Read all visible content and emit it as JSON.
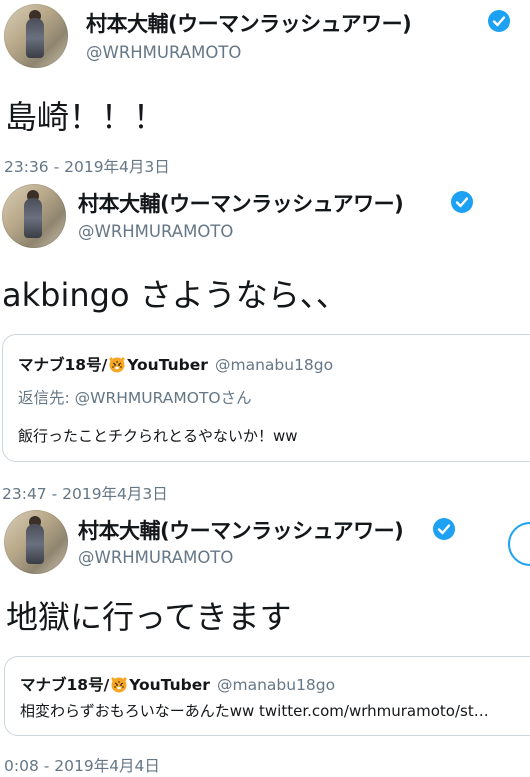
{
  "colors": {
    "verified": "#1da1f2",
    "text": "#14171a",
    "muted": "#657786",
    "border": "#ccd6dd"
  },
  "tweets": [
    {
      "name": "村本大輔(ウーマンラッシュアワー)",
      "handle": "@WRHMURAMOTO",
      "text": "島崎！！！",
      "timestamp": "23:36 - 2019年4月3日",
      "verified_icon": "verified-badge-icon"
    },
    {
      "name": "村本大輔(ウーマンラッシュアワー)",
      "handle": "@WRHMURAMOTO",
      "text": "akbingo さようなら、、",
      "quote": {
        "name_prefix": "マナブ18号/",
        "name_suffix": "YouTuber",
        "handle": "@manabu18go",
        "reply_label": "返信先: ",
        "reply_to": "@WRHMURAMOTOさん",
        "text": "飯行ったことチクられとるやないか！ww"
      },
      "timestamp": "23:47 - 2019年4月3日"
    },
    {
      "name": "村本大輔(ウーマンラッシュアワー)",
      "handle": "@WRHMURAMOTO",
      "text": "地獄に行ってきます",
      "quote": {
        "name_prefix": "マナブ18号/",
        "name_suffix": "YouTuber",
        "handle": "@manabu18go",
        "text": "相変わらずおもろいなーあんたww twitter.com/wrhmuramoto/st…"
      },
      "timestamp": "0:08 - 2019年4月4日"
    }
  ]
}
